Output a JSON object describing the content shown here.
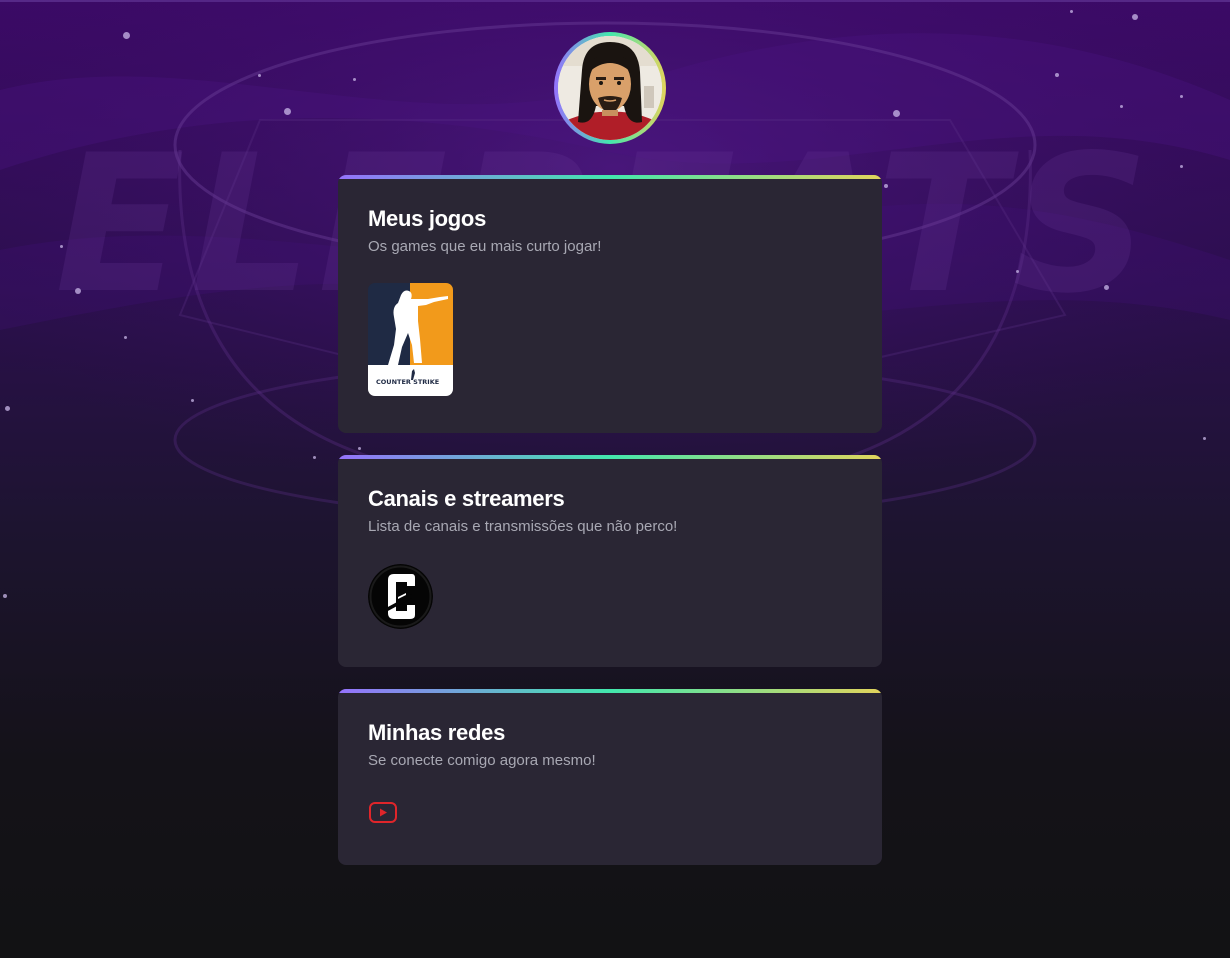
{
  "profile": {
    "avatar_alt": "Foto de perfil"
  },
  "background": {
    "watermark_text": "ELEREATS"
  },
  "sections": {
    "games": {
      "title": "Meus jogos",
      "subtitle": "Os games que eu mais curto jogar!",
      "items": [
        {
          "name": "CS:GO",
          "logo_text": "COUNTER STRIKE",
          "icon": "counter-strike-icon"
        }
      ]
    },
    "channels": {
      "title": "Canais e streamers",
      "subtitle": "Lista de canais e transmissões que não perco!",
      "items": [
        {
          "name": "Gaules",
          "icon": "gaules-channel-icon"
        }
      ]
    },
    "social": {
      "title": "Minhas redes",
      "subtitle": "Se conecte comigo agora mesmo!",
      "items": [
        {
          "name": "YouTube",
          "icon": "youtube-icon"
        }
      ]
    }
  },
  "colors": {
    "accent_gradient": [
      "#9572fc",
      "#43e7ad",
      "#e2d45c"
    ],
    "card_bg": "#2a2634",
    "youtube_red": "#e0252a"
  }
}
